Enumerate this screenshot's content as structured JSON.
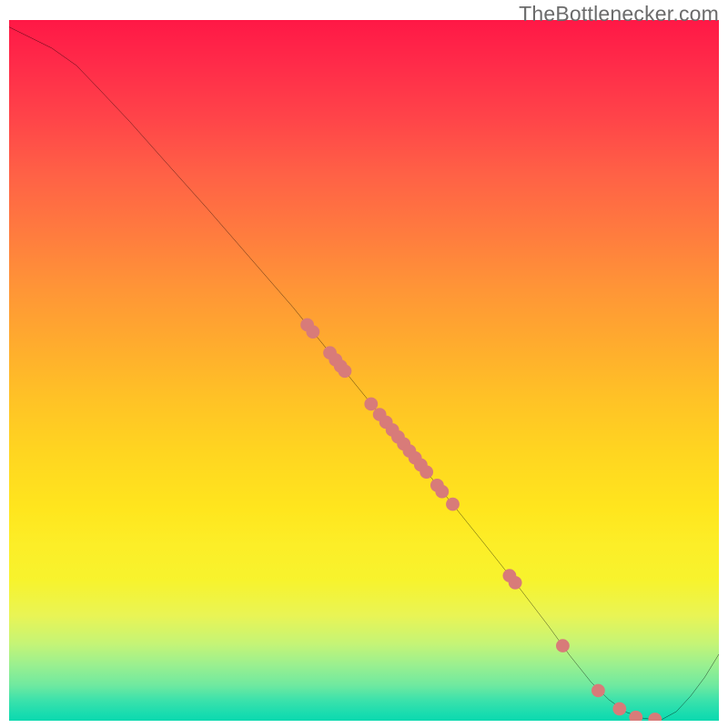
{
  "attribution": "TheBottlenecker.com",
  "chart_data": {
    "type": "line",
    "title": "",
    "xlabel": "",
    "ylabel": "",
    "xlim": [
      0,
      100
    ],
    "ylim": [
      0,
      100
    ],
    "curve": [
      {
        "x": 0.0,
        "y": 99.0
      },
      {
        "x": 3.0,
        "y": 97.5
      },
      {
        "x": 6.0,
        "y": 96.0
      },
      {
        "x": 9.5,
        "y": 93.5
      },
      {
        "x": 13.0,
        "y": 89.8
      },
      {
        "x": 17.0,
        "y": 85.5
      },
      {
        "x": 22.0,
        "y": 79.8
      },
      {
        "x": 28.0,
        "y": 73.0
      },
      {
        "x": 34.0,
        "y": 66.0
      },
      {
        "x": 40.0,
        "y": 59.0
      },
      {
        "x": 46.0,
        "y": 51.5
      },
      {
        "x": 52.0,
        "y": 44.0
      },
      {
        "x": 57.0,
        "y": 37.8
      },
      {
        "x": 62.0,
        "y": 31.5
      },
      {
        "x": 67.0,
        "y": 25.2
      },
      {
        "x": 72.0,
        "y": 18.8
      },
      {
        "x": 76.0,
        "y": 13.5
      },
      {
        "x": 79.0,
        "y": 9.3
      },
      {
        "x": 82.0,
        "y": 5.5
      },
      {
        "x": 84.5,
        "y": 3.0
      },
      {
        "x": 87.0,
        "y": 1.2
      },
      {
        "x": 89.5,
        "y": 0.3
      },
      {
        "x": 92.0,
        "y": 0.2
      },
      {
        "x": 94.0,
        "y": 1.3
      },
      {
        "x": 96.0,
        "y": 3.5
      },
      {
        "x": 98.0,
        "y": 6.2
      },
      {
        "x": 100.0,
        "y": 9.5
      }
    ],
    "points": [
      {
        "x": 42.0,
        "y": 56.5
      },
      {
        "x": 42.8,
        "y": 55.5
      },
      {
        "x": 45.2,
        "y": 52.5
      },
      {
        "x": 46.0,
        "y": 51.5
      },
      {
        "x": 46.7,
        "y": 50.6
      },
      {
        "x": 47.3,
        "y": 49.9
      },
      {
        "x": 51.0,
        "y": 45.2
      },
      {
        "x": 52.2,
        "y": 43.7
      },
      {
        "x": 53.1,
        "y": 42.6
      },
      {
        "x": 54.0,
        "y": 41.5
      },
      {
        "x": 54.8,
        "y": 40.5
      },
      {
        "x": 55.6,
        "y": 39.5
      },
      {
        "x": 56.4,
        "y": 38.5
      },
      {
        "x": 57.2,
        "y": 37.5
      },
      {
        "x": 58.0,
        "y": 36.5
      },
      {
        "x": 58.8,
        "y": 35.5
      },
      {
        "x": 60.3,
        "y": 33.6
      },
      {
        "x": 61.0,
        "y": 32.7
      },
      {
        "x": 62.5,
        "y": 30.9
      },
      {
        "x": 70.5,
        "y": 20.7
      },
      {
        "x": 71.3,
        "y": 19.7
      },
      {
        "x": 78.0,
        "y": 10.7
      },
      {
        "x": 83.0,
        "y": 4.3
      },
      {
        "x": 86.0,
        "y": 1.7
      },
      {
        "x": 88.3,
        "y": 0.5
      },
      {
        "x": 91.0,
        "y": 0.2
      }
    ],
    "point_color": "#d87b79",
    "curve_color": "#000000",
    "curve_width": 2
  }
}
